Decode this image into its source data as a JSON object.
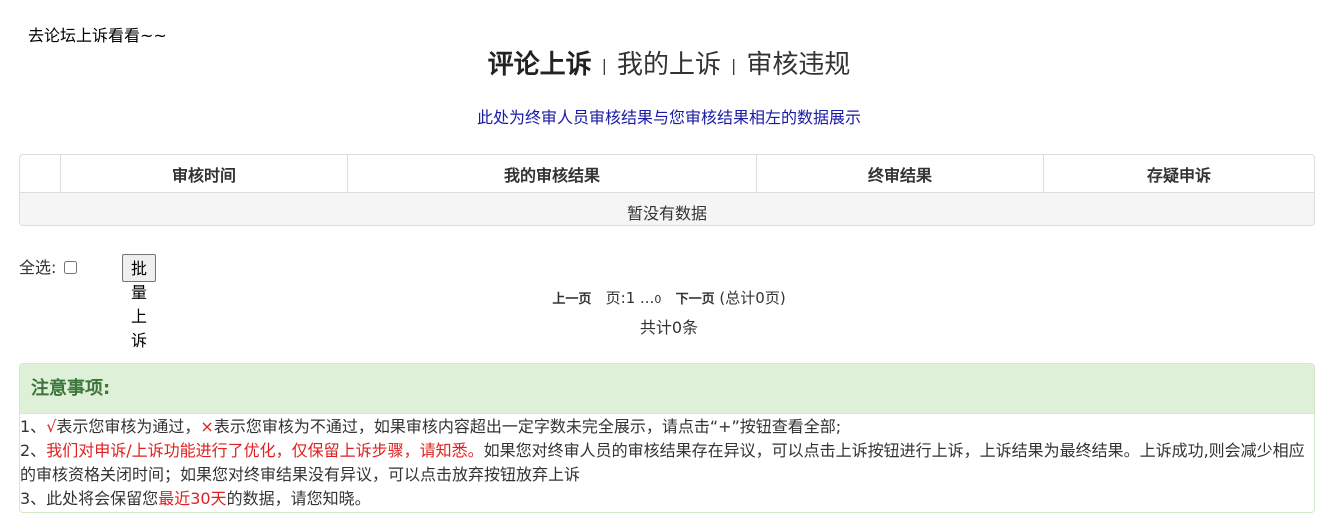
{
  "forum_link": "去论坛上诉看看~~",
  "tabs": [
    {
      "label": "评论上诉",
      "active": true
    },
    {
      "label": "我的上诉",
      "active": false
    },
    {
      "label": "审核违规",
      "active": false
    }
  ],
  "tab_separator": "|",
  "notice_top": "此处为终审人员审核结果与您审核结果相左的数据展示",
  "table": {
    "headers": [
      "",
      "审核时间",
      "我的审核结果",
      "终审结果",
      "存疑申诉"
    ],
    "empty_text": "暂没有数据"
  },
  "batch": {
    "select_all_label": "全选:",
    "button_label": "批量上诉"
  },
  "pager": {
    "prev_label": "上一页",
    "page_text": "页:1 ...",
    "page_small": "0",
    "next_label": "下一页",
    "total_pages_text": "(总计0页)",
    "total_items_text": "共计0条"
  },
  "notes": {
    "title": "注意事项:",
    "line1_a": "1、",
    "line1_check": "√",
    "line1_b": "表示您审核为通过，",
    "line1_cross": "×",
    "line1_c": "表示您审核为不通过，如果审核内容超出一定字数未完全展示，请点击“+”按钮查看全部;",
    "line2_a": "2、",
    "line2_red": "我们对申诉/上诉功能进行了优化，仅保留上诉步骤，请知悉。",
    "line2_b": "如果您对终审人员的审核结果存在异议，可以点击上诉按钮进行上诉，上诉结果为最终结果。上诉成功,则会减少相应的审核资格关闭时间；如果您对终审结果没有异议，可以点击放弃按钮放弃上诉",
    "line3_a": "3、此处将会保留您",
    "line3_red": "最近30天",
    "line3_b": "的数据，请您知晓。"
  },
  "colors": {
    "notice_blue": "#1a1aa6",
    "warning_red": "#e02020",
    "panel_green_bg": "#dff0d8",
    "panel_green_text": "#3c763d"
  }
}
